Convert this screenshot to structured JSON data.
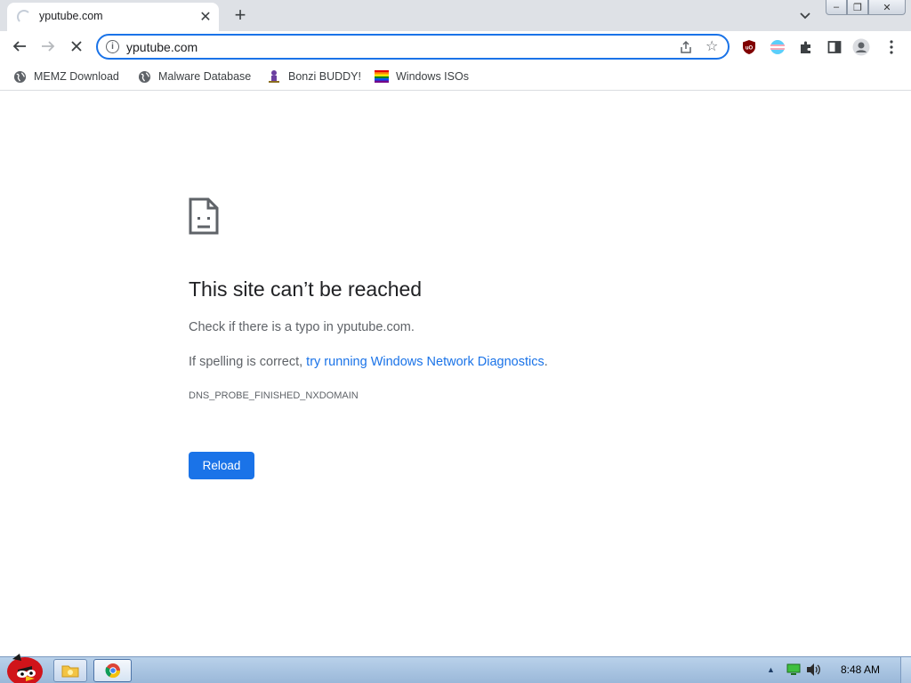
{
  "tab": {
    "title": "yputube.com",
    "close_glyph": "✕",
    "new_tab_glyph": "+"
  },
  "window": {
    "minimize_glyph": "–",
    "maximize_glyph": "❐",
    "close_glyph": "✕"
  },
  "toolbar": {
    "url": "yputube.com",
    "info_glyph": "i",
    "star_glyph": "☆"
  },
  "bookmarks": [
    {
      "label": "MEMZ Download",
      "icon": "globe-icon"
    },
    {
      "label": "Malware Database",
      "icon": "globe-icon"
    },
    {
      "label": "Bonzi BUDDY!",
      "icon": "bonzi-icon"
    },
    {
      "label": "Windows ISOs",
      "icon": "rainbow-flag-icon"
    }
  ],
  "error": {
    "title": "This site can’t be reached",
    "hint": "Check if there is a typo in yputube.com.",
    "spelling_prefix": "If spelling is correct, ",
    "spelling_link": "try running Windows Network Diagnostics",
    "spelling_suffix": ".",
    "code": "DNS_PROBE_FINISHED_NXDOMAIN",
    "reload_label": "Reload"
  },
  "taskbar": {
    "clock": "8:48 AM",
    "tray_up_glyph": "▲"
  },
  "colors": {
    "accent": "#1a73e8",
    "tabstrip": "#dee1e6",
    "taskbar": "#a9c3e0"
  }
}
